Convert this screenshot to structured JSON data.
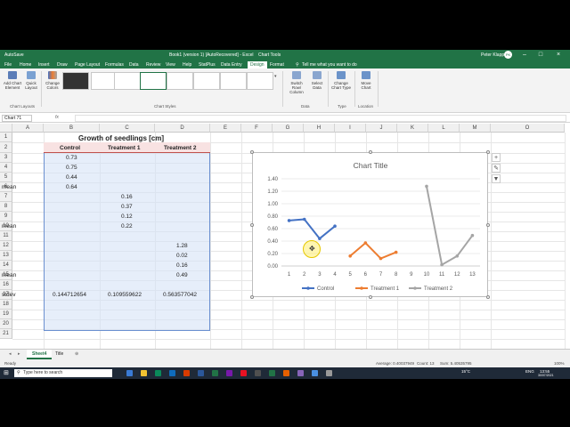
{
  "window": {
    "title": "Book1 (version 1) [AutoRecovered] - Excel",
    "chart_tools": "Chart Tools",
    "user": "Peter Klappa",
    "user_initials": "PK"
  },
  "menu": [
    "File",
    "Home",
    "Insert",
    "Draw",
    "Page Layout",
    "Formulas",
    "Data",
    "Review",
    "View",
    "Help",
    "StatPlus",
    "Data Entry",
    "Design",
    "Format"
  ],
  "tell_me": "Tell me what you want to do",
  "ribbon": {
    "add_chart_element": "Add Chart Element",
    "quick_layout": "Quick Layout",
    "change_colors": "Change Colors",
    "switch_row_column": "Switch Row/ Column",
    "select_data": "Select Data",
    "change_chart_type": "Change Chart Type",
    "move_chart": "Move Chart",
    "groups": {
      "chart_layouts": "Chart Layouts",
      "chart_styles": "Chart Styles",
      "data": "Data",
      "type": "Type",
      "location": "Location"
    }
  },
  "formula_bar": {
    "name_box": "Chart 71",
    "fx": "fx",
    "content": ""
  },
  "columns": [
    "A",
    "B",
    "C",
    "D",
    "E",
    "F",
    "G",
    "H",
    "I",
    "J",
    "K",
    "L",
    "M",
    "O"
  ],
  "rows": [
    "1",
    "2",
    "3",
    "4",
    "5",
    "6",
    "7",
    "8",
    "9",
    "10",
    "11",
    "12",
    "13",
    "14",
    "15",
    "16",
    "17",
    "18",
    "19",
    "20",
    "21"
  ],
  "sheet": {
    "title": "Growth of seedlings [cm]",
    "headers": [
      "Control",
      "Treatment 1",
      "Treatment 2"
    ],
    "control": [
      "0.73",
      "0.75",
      "0.44"
    ],
    "control_mean": "0.64",
    "t1": [
      "0.16",
      "0.37",
      "0.12"
    ],
    "t1_mean": "0.22",
    "t2": [
      "1.28",
      "0.02",
      "0.16"
    ],
    "t2_mean": "0.49",
    "mean_label": "mean",
    "stdev_label": "stdev",
    "stdev": [
      "0.144712654",
      "0.109559622",
      "0.563577042"
    ]
  },
  "chart_data": {
    "type": "line",
    "title": "Chart Title",
    "categories": [
      "1",
      "2",
      "3",
      "4",
      "5",
      "6",
      "7",
      "8",
      "9",
      "10",
      "11",
      "12",
      "13"
    ],
    "ylim": [
      0,
      1.4
    ],
    "yticks": [
      "0.00",
      "0.20",
      "0.40",
      "0.60",
      "0.80",
      "1.00",
      "1.20",
      "1.40"
    ],
    "grid": true,
    "legend": "bottom",
    "series": [
      {
        "name": "Control",
        "color": "#4472c4",
        "x": [
          1,
          2,
          3,
          4
        ],
        "values": [
          0.73,
          0.75,
          0.44,
          0.64
        ]
      },
      {
        "name": "Treatment 1",
        "color": "#ed7d31",
        "x": [
          5,
          6,
          7,
          8
        ],
        "values": [
          0.16,
          0.37,
          0.12,
          0.22
        ]
      },
      {
        "name": "Treatment 2",
        "color": "#a5a5a5",
        "x": [
          10,
          11,
          12,
          13
        ],
        "values": [
          1.28,
          0.02,
          0.16,
          0.49
        ]
      }
    ]
  },
  "sheet_tabs": [
    "Sheet4",
    "Title"
  ],
  "status": {
    "ready": "Ready",
    "average": "Average: 0.40037949",
    "count": "Count: 13",
    "sum": "Sum: 5.40535795",
    "zoom": "100%"
  },
  "taskbar": {
    "search_placeholder": "Type here to search",
    "weather": "15°C",
    "lang": "ENG",
    "time": "13:55",
    "date": "30/07/2021"
  }
}
